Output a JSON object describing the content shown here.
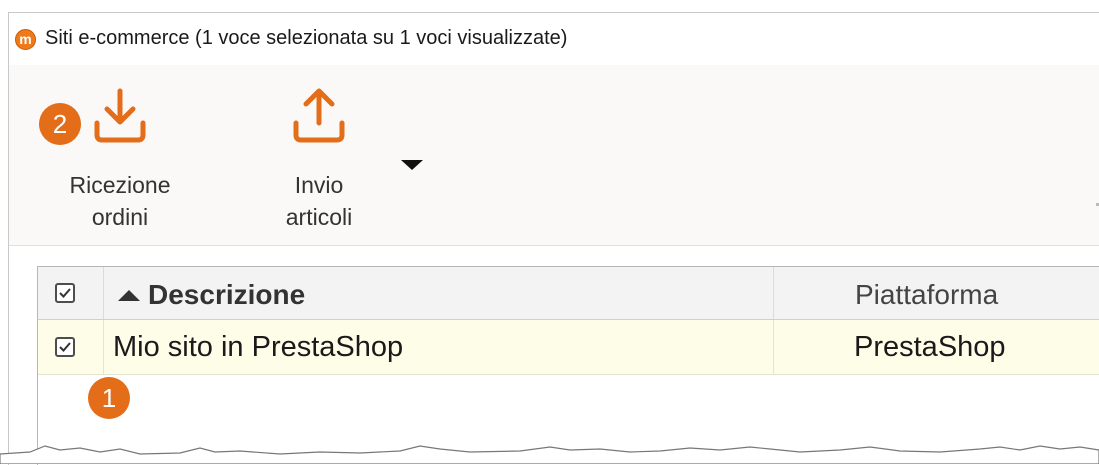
{
  "window": {
    "title": "Siti e-commerce (1 voce selezionata su 1 voci visualizzate)",
    "app_icon_letter": "m"
  },
  "ribbon": {
    "buttons": [
      {
        "line1": "Ricezione",
        "line2": "ordini",
        "icon": "download-icon"
      },
      {
        "line1": "Invio",
        "line2": "articoli",
        "icon": "upload-icon"
      }
    ],
    "more_icon": "dropdown-arrow-icon"
  },
  "badges": {
    "step1": "1",
    "step2": "2"
  },
  "grid": {
    "columns": [
      {
        "label": "Descrizione",
        "sorted": "ascending"
      },
      {
        "label": "Piattaforma"
      }
    ],
    "rows": [
      {
        "checked": true,
        "descrizione": "Mio sito in PrestaShop",
        "piattaforma": "PrestaShop"
      }
    ]
  },
  "colors": {
    "accent": "#e36d18",
    "selected_row": "#fefde8",
    "header_bg": "#f3f3f3",
    "ribbon_bg": "#faf9f7"
  }
}
